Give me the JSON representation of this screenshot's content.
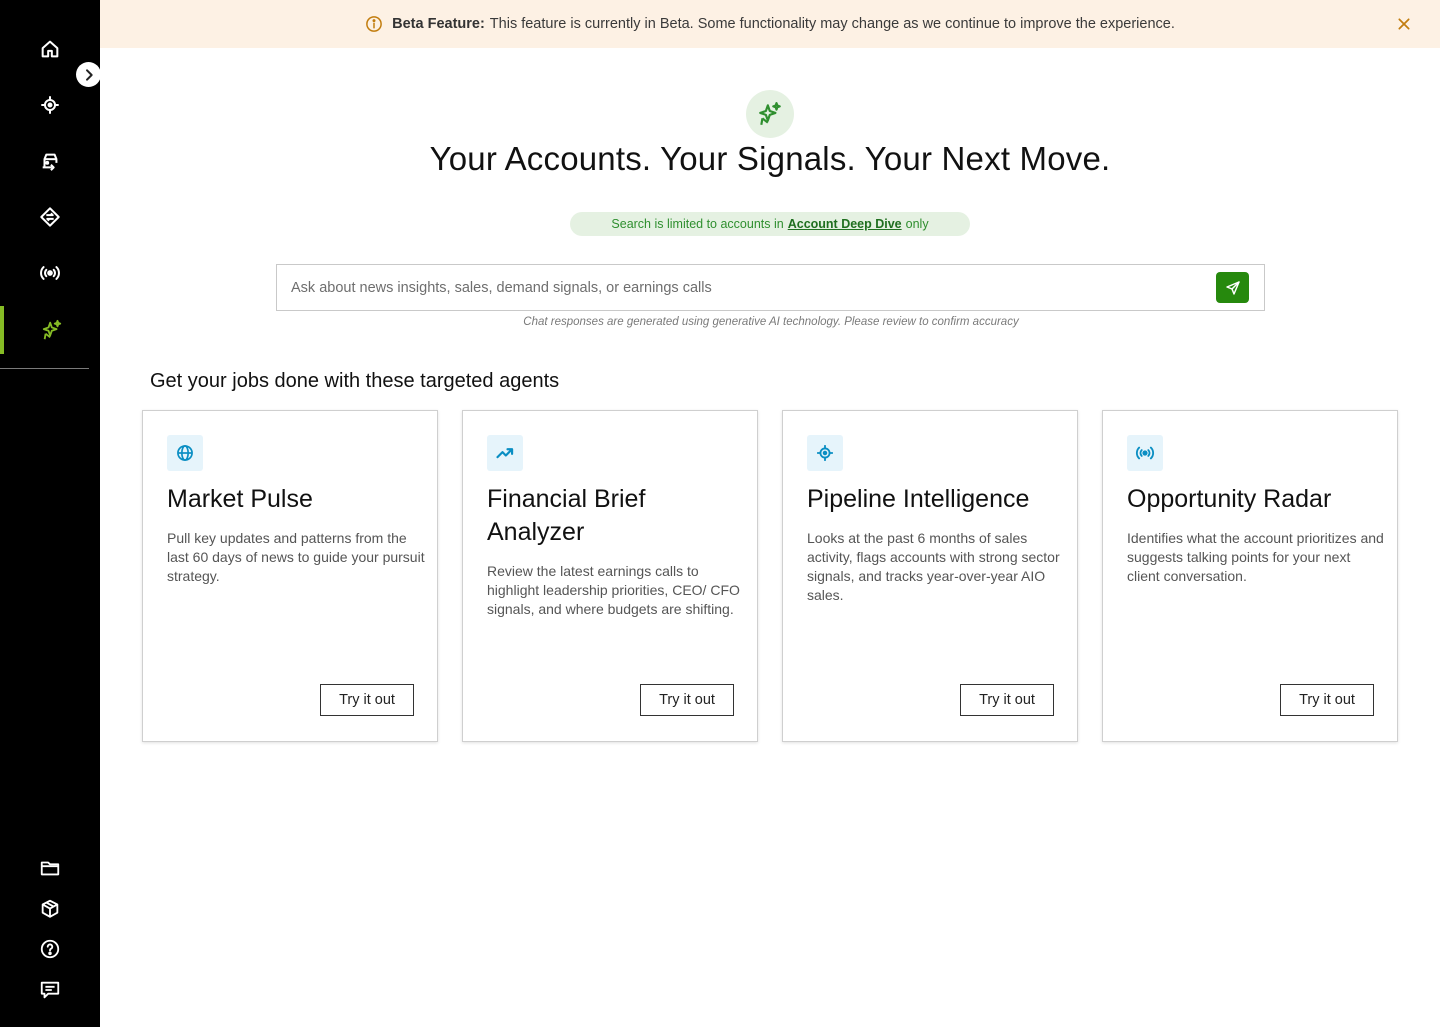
{
  "banner": {
    "icon": "info-icon",
    "label": "Beta Feature:",
    "message": "This feature is currently in Beta. Some functionality may change as we continue to improve the experience.",
    "accent_color": "#c27d0e",
    "background": "#fdf1e4"
  },
  "sidebar": {
    "active_accent": "#86bc25",
    "top_items": [
      {
        "icon": "home-icon"
      },
      {
        "icon": "target-icon"
      },
      {
        "icon": "car-icon"
      },
      {
        "icon": "diamond-arrows-icon"
      },
      {
        "icon": "broadcast-icon"
      },
      {
        "icon": "sparkle-icon",
        "active": true
      }
    ],
    "bottom_items": [
      {
        "icon": "folder-icon"
      },
      {
        "icon": "box-icon"
      },
      {
        "icon": "help-icon"
      },
      {
        "icon": "chat-icon"
      }
    ]
  },
  "hero": {
    "icon": "sparkle-icon",
    "title": "Your Accounts. Your Signals. Your Next Move."
  },
  "scope": {
    "prefix": "Search is limited to accounts in",
    "link": "Account Deep Dive",
    "suffix": "only",
    "color": "#2f8f2f"
  },
  "search": {
    "placeholder": "Ask about news insights, sales, demand signals, or earnings calls",
    "value": "",
    "send_icon": "send-icon",
    "button_color": "#26890d"
  },
  "disclaimer": "Chat responses are generated using generative AI technology. Please review to confirm accuracy",
  "agents": {
    "section_title": "Get your jobs done with these targeted agents",
    "cards": [
      {
        "icon": "globe-icon",
        "title": "Market Pulse",
        "description": "Pull key updates and patterns from the last 60 days of news to guide your pursuit strategy.",
        "button": "Try it out"
      },
      {
        "icon": "trend-up-icon",
        "title": "Financial Brief Analyzer",
        "description": "Review the latest earnings calls to highlight leadership priorities, CEO/ CFO signals, and where budgets are shifting.",
        "button": "Try it out"
      },
      {
        "icon": "target-icon",
        "title": "Pipeline Intelligence",
        "description": "Looks at the past 6 months of sales activity, flags accounts with strong sector signals, and tracks year-over-year AIO sales.",
        "button": "Try it out"
      },
      {
        "icon": "broadcast-icon",
        "title": "Opportunity Radar",
        "description": "Identifies what the account prioritizes and suggests talking points for your next client conversation.",
        "button": "Try it out"
      }
    ]
  }
}
